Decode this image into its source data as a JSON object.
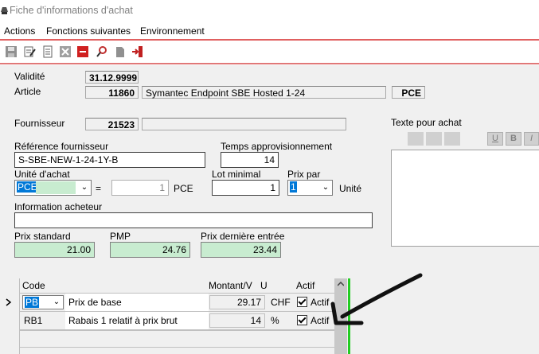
{
  "window": {
    "title": "Fiche d'informations d'achat"
  },
  "menu": [
    "Actions",
    "Fonctions suivantes",
    "Environnement"
  ],
  "toolbar": {
    "icons": [
      "save-icon",
      "edit-icon",
      "document-icon",
      "cancel-icon",
      "delete-icon",
      "search-icon",
      "blank-icon",
      "exit-icon"
    ]
  },
  "form": {
    "validite_label": "Validité",
    "validite_value": "31.12.9999",
    "article_label": "Article",
    "article_number": "11860",
    "article_name": "Symantec Endpoint SBE Hosted 1-24",
    "article_unit": "PCE",
    "fournisseur_label": "Fournisseur",
    "fournisseur_number": "21523",
    "fournisseur_name": "",
    "ref_fournisseur_label": "Référence fournisseur",
    "ref_fournisseur_value": "S-SBE-NEW-1-24-1Y-B",
    "temps_appro_label": "Temps approvisionnement",
    "temps_appro_value": "14",
    "unite_achat_label": "Unité d'achat",
    "unite_achat_value": "PCE",
    "equals": "=",
    "conversion_value": "1",
    "conversion_unit": "PCE",
    "lot_minimal_label": "Lot minimal",
    "lot_minimal_value": "1",
    "prix_par_label": "Prix par",
    "prix_par_value": "1",
    "prix_par_unit": "Unité",
    "info_acheteur_label": "Information acheteur",
    "info_acheteur_value": "",
    "prix_standard_label": "Prix standard",
    "prix_standard_value": "21.00",
    "pmp_label": "PMP",
    "pmp_value": "24.76",
    "prix_derniere_label": "Prix dernière entrée",
    "prix_derniere_value": "23.44",
    "texte_achat_label": "Texte pour achat",
    "format_buttons": [
      "U",
      "B",
      "I"
    ]
  },
  "grid": {
    "headers": {
      "code": "Code",
      "montant": "Montant/V",
      "u": "U",
      "actif": "Actif"
    },
    "rows": [
      {
        "code": "PB",
        "description": "Prix de base",
        "montant": "29.17",
        "unit": "CHF",
        "actif": "Actif"
      },
      {
        "code": "RB1",
        "description": "Rabais 1 relatif à prix brut",
        "montant": "14",
        "unit": "%",
        "actif": "Actif"
      }
    ]
  },
  "colors": {
    "accent_red": "#e06060",
    "price_green": "#c8ecd0",
    "green_bar": "#22cc22",
    "selection": "#0078d7"
  }
}
